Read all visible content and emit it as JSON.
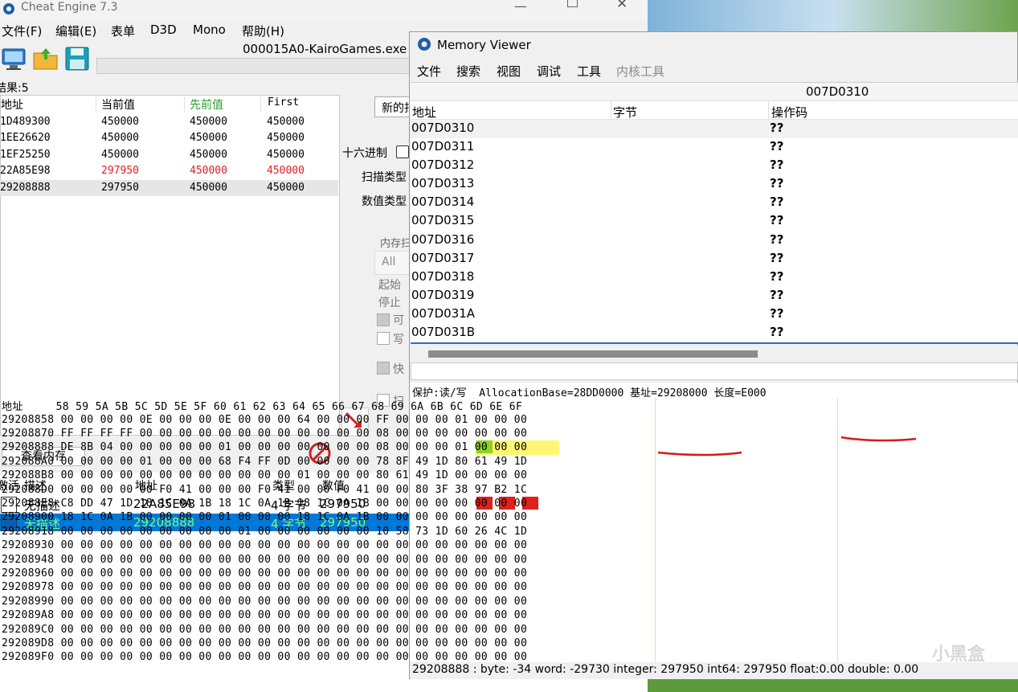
{
  "ce": {
    "title": "Cheat Engine 7.3",
    "process": "000015A0-KairoGames.exe",
    "menu": [
      "文件(F)",
      "编辑(E)",
      "表单",
      "D3D",
      "Mono",
      "帮助(H)"
    ],
    "results_label": "结果:5",
    "columns": [
      "地址",
      "当前值",
      "先前值",
      "First"
    ],
    "results": [
      {
        "addr": "1D489300",
        "cur": "450000",
        "prev": "450000",
        "first": "450000",
        "changed": false
      },
      {
        "addr": "1EE26620",
        "cur": "450000",
        "prev": "450000",
        "first": "450000",
        "changed": false
      },
      {
        "addr": "1EF25250",
        "cur": "450000",
        "prev": "450000",
        "first": "450000",
        "changed": false
      },
      {
        "addr": "22A85E98",
        "cur": "297950",
        "prev": "450000",
        "first": "450000",
        "changed": true
      },
      {
        "addr": "29208888",
        "cur": "297950",
        "prev": "450000",
        "first": "450000",
        "changed": false
      }
    ],
    "new_scan_btn": "新的扫",
    "hex_label": "十六进制",
    "scan_type_label": "扫描类型",
    "value_type_label": "数值类型",
    "mem_label": "内存扫",
    "all_label": "All",
    "start_label": "起始",
    "stop_label": "停止",
    "opt1": "可",
    "opt2": "写",
    "opt3": "快",
    "opt4": "扫",
    "view_mem_btn": "查看内存",
    "bottom_cols": [
      "激活",
      "描述",
      "地址",
      "类型",
      "数值"
    ],
    "cheat_rows": [
      {
        "desc": "无描述",
        "addr": "22A85E98",
        "type": "4 字节",
        "value": "297950",
        "selected": false
      },
      {
        "desc": "无描述",
        "addr": "29208888",
        "type": "4 字节",
        "value": "297950",
        "selected": true
      }
    ]
  },
  "mv": {
    "title": "Memory Viewer",
    "menu": [
      "文件",
      "搜索",
      "视图",
      "调试",
      "工具",
      "内核工具"
    ],
    "current_addr": "007D0310",
    "dis_cols": [
      "地址",
      "字节",
      "操作码"
    ],
    "dis_rows": [
      {
        "addr": "007D0310",
        "op": "??"
      },
      {
        "addr": "007D0311",
        "op": "??"
      },
      {
        "addr": "007D0312",
        "op": "??"
      },
      {
        "addr": "007D0313",
        "op": "??"
      },
      {
        "addr": "007D0314",
        "op": "??"
      },
      {
        "addr": "007D0315",
        "op": "??"
      },
      {
        "addr": "007D0316",
        "op": "??"
      },
      {
        "addr": "007D0317",
        "op": "??"
      },
      {
        "addr": "007D0318",
        "op": "??"
      },
      {
        "addr": "007D0319",
        "op": "??"
      },
      {
        "addr": "007D031A",
        "op": "??"
      },
      {
        "addr": "007D031B",
        "op": "??"
      }
    ],
    "protect_line": "保护:读/写  AllocationBase=28DD0000 基址=29208000 长度=E000",
    "hex_header": "地址     58 59 5A 5B 5C 5D 5E 5F 60 61 62 63 64 65 66 67 68 69 6A 6B 6C 6D 6E 6F",
    "hex_rows": [
      "29208858 00 00 00 00 0E 00 00 00 0E 00 00 00 64 00 00 00 FF 00 00 00 01 00 00 00",
      "29208870 FF FF FF FF 00 00 00 00 00 00 00 00 00 00 00 00 08 00 00 00 00 00 00 00",
      "29208888 DE 8B 04 00 00 00 00 00 01 00 00 00 00 00 00 00 08 00 00 00 01 00 00 00",
      "292088A0 00 00 00 00 01 00 00 00 68 F4 FF 0D 00 00 00 00 78 8F 49 1D 80 61 49 1D",
      "292088B8 00 00 00 00 00 00 00 00 00 00 00 00 01 00 00 00 80 61 49 1D 00 00 00 00",
      "292088D0 00 00 00 00 00 F0 41 00 00 00 F0 41 00 00 F0 41 00 00 80 3F 38 97 B2 1C",
      "292088E8 C8 DD 47 1D 18 1C 0A 1B 18 1C 0A 1B 18 1C 0A 1B 00 00 00 00 00 00 00 00",
      "29208900 18 1C 0A 1B 00 00 00 00 01 00 00 00 18 1C 0A 1B 00 00 00 00 00 00 00 00",
      "29208918 00 00 00 00 00 00 00 00 00 01 00 00 00 00 00 00 10 58 73 1D 60 26 4C 1D",
      "29208930 00 00 00 00 00 00 00 00 00 00 00 00 00 00 00 00 00 00 00 00 00 00 00 00",
      "29208948 00 00 00 00 00 00 00 00 00 00 00 00 00 00 00 00 00 00 00 00 00 00 00 00",
      "29208960 00 00 00 00 00 00 00 00 00 00 00 00 00 00 00 00 00 00 00 00 00 00 00 00",
      "29208978 00 00 00 00 00 00 00 00 00 00 00 00 00 00 00 00 00 00 00 00 00 00 00 00",
      "29208990 00 00 00 00 00 00 00 00 00 00 00 00 00 00 00 00 00 00 00 00 00 00 00 00",
      "292089A8 00 00 00 00 00 00 00 00 00 00 00 00 00 00 00 00 00 00 00 00 00 00 00 00",
      "292089C0 00 00 00 00 00 00 00 00 00 00 00 00 00 00 00 00 00 00 00 00 00 00 00 00",
      "292089D8 00 00 00 00 00 00 00 00 00 00 00 00 00 00 00 00 00 00 00 00 00 00 00 00",
      "292089F0 00 00 00 00 00 00 00 00 00 00 00 00 00 00 00 00 00 00 00 00 00 00 00 00"
    ],
    "status_line": "29208888 : byte: -34 word: -29730 integer: 297950 int64: 297950 float:0.00 double: 0.00"
  },
  "watermark": "小黑盒"
}
